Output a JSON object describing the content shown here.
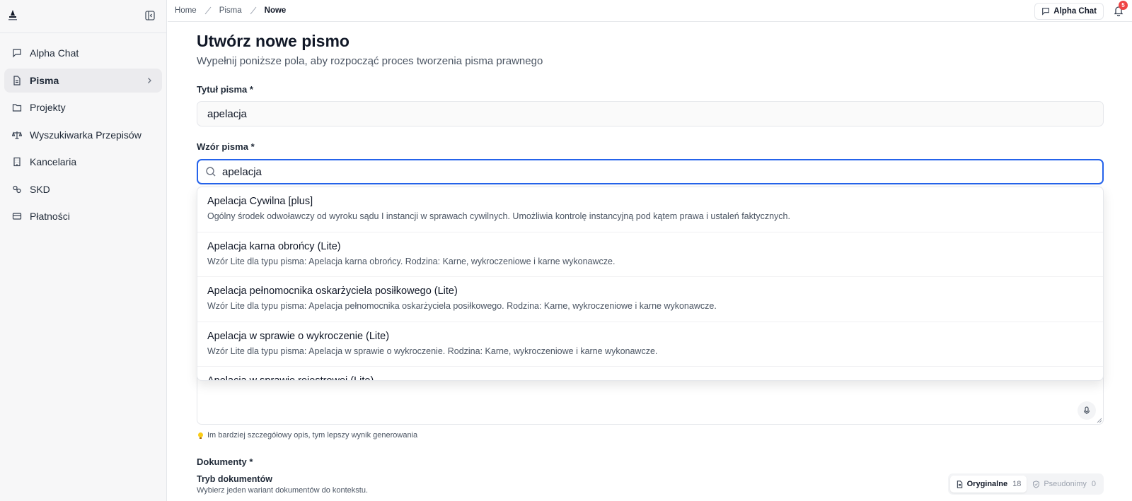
{
  "sidebar": {
    "items": [
      {
        "label": "Alpha Chat",
        "icon": "message-square-icon"
      },
      {
        "label": "Pisma",
        "icon": "file-text-icon",
        "active": true
      },
      {
        "label": "Projekty",
        "icon": "folder-icon"
      },
      {
        "label": "Wyszukiwarka Przepisów",
        "icon": "scale-icon"
      },
      {
        "label": "Kancelaria",
        "icon": "building-icon"
      },
      {
        "label": "SKD",
        "icon": "link-icon"
      },
      {
        "label": "Płatności",
        "icon": "credit-card-icon"
      }
    ]
  },
  "header": {
    "breadcrumbs": [
      "Home",
      "Pisma",
      "Nowe"
    ],
    "chat_button": "Alpha Chat",
    "notification_count": "5"
  },
  "form": {
    "title": "Utwórz nowe pismo",
    "subtitle": "Wypełnij poniższe pola, aby rozpocząć proces tworzenia pisma prawnego",
    "title_label": "Tytuł pisma *",
    "title_value": "apelacja",
    "template_label": "Wzór pisma *",
    "template_search": "apelacja",
    "hint": "Im bardziej szczegółowy opis, tym lepszy wynik generowania",
    "documents_label": "Dokumenty *",
    "mode_title": "Tryb dokumentów",
    "mode_subtitle": "Wybierz jeden wariant dokumentów do kontekstu.",
    "mode_original": "Oryginalne",
    "mode_original_count": "18",
    "mode_pseudo": "Pseudonimy",
    "mode_pseudo_count": "0"
  },
  "dropdown": {
    "options": [
      {
        "title": "Apelacja Cywilna [plus]",
        "desc": "Ogólny środek odwoławczy od wyroku sądu I instancji w sprawach cywilnych. Umożliwia kontrolę instancyjną pod kątem prawa i ustaleń faktycznych."
      },
      {
        "title": "Apelacja karna obrońcy (Lite)",
        "desc": "Wzór Lite dla typu pisma: Apelacja karna obrońcy. Rodzina: Karne, wykroczeniowe i karne wykonawcze."
      },
      {
        "title": "Apelacja pełnomocnika oskarżyciela posiłkowego (Lite)",
        "desc": "Wzór Lite dla typu pisma: Apelacja pełnomocnika oskarżyciela posiłkowego. Rodzina: Karne, wykroczeniowe i karne wykonawcze."
      },
      {
        "title": "Apelacja w sprawie o wykroczenie (Lite)",
        "desc": "Wzór Lite dla typu pisma: Apelacja w sprawie o wykroczenie. Rodzina: Karne, wykroczeniowe i karne wykonawcze."
      },
      {
        "title": "Apelacja w sprawie rejestrowej (Lite)",
        "desc": ""
      }
    ]
  },
  "colors": {
    "accent": "#2563eb",
    "badge": "#ef4444",
    "active_nav": "#ebebee"
  }
}
